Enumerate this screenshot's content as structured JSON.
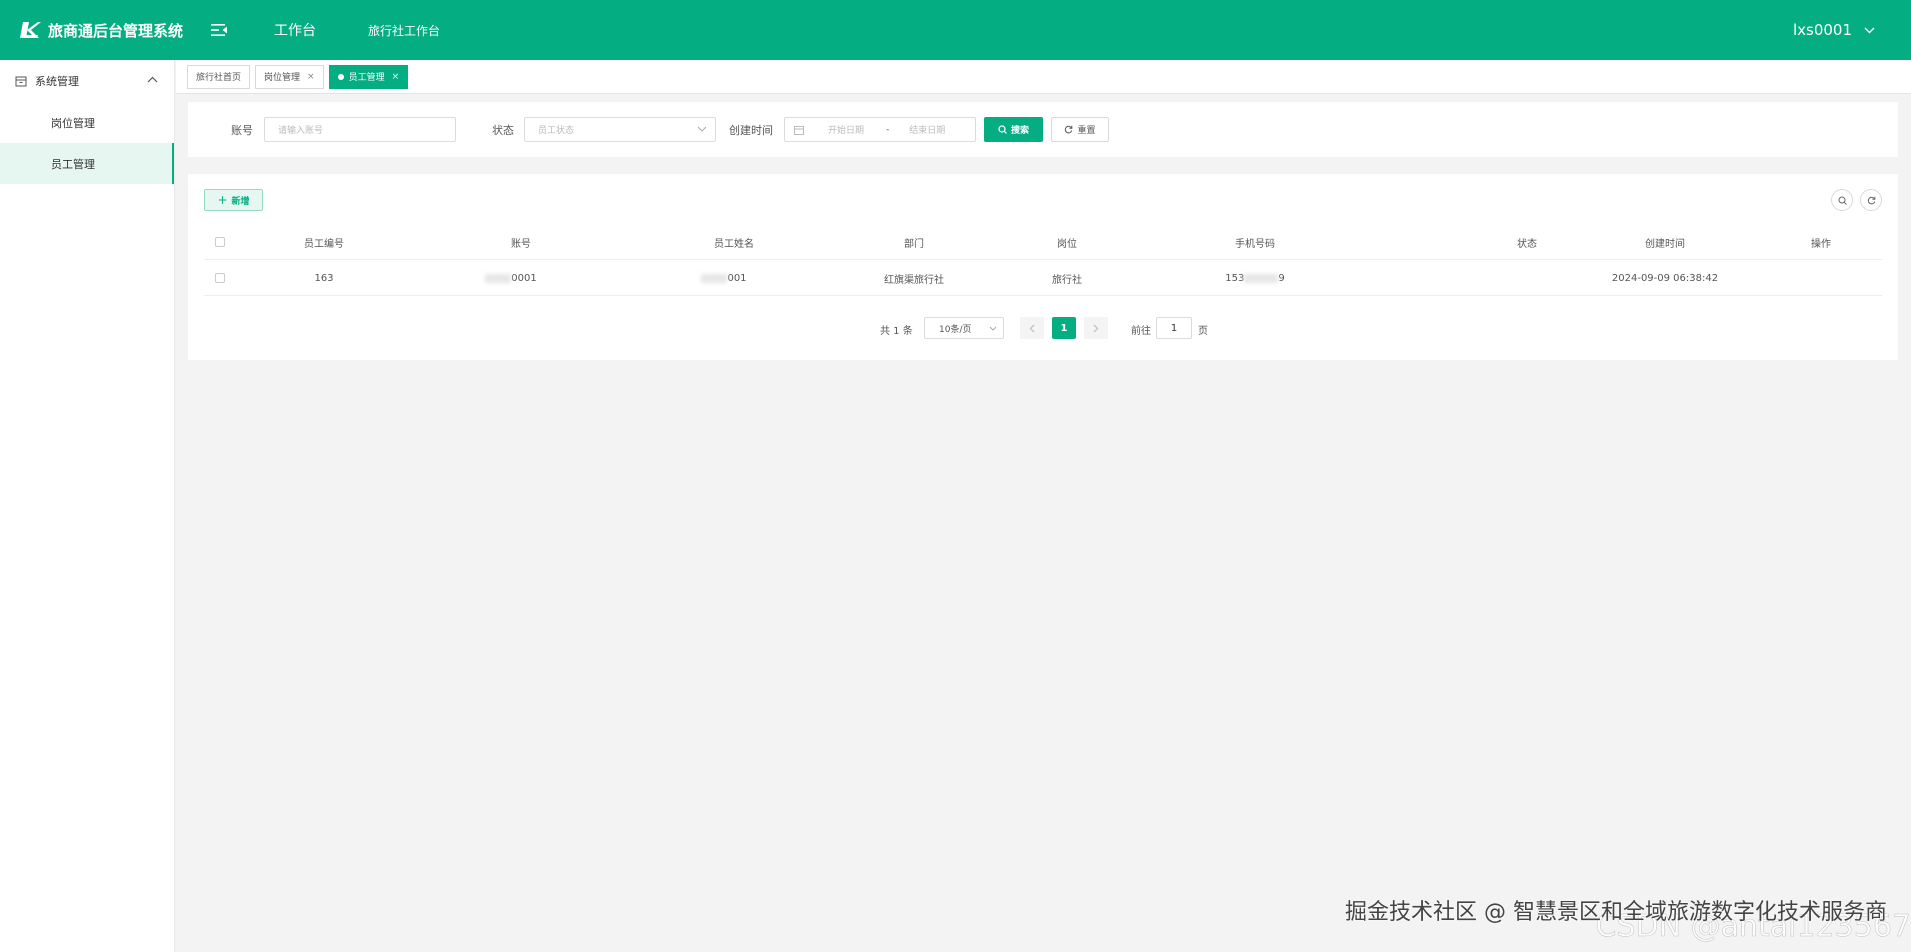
{
  "header": {
    "app_title": "旅商通后台管理系统",
    "nav": [
      "工作台",
      "旅行社工作台"
    ],
    "user_name": "lxs0001"
  },
  "sidebar": {
    "group_label": "系统管理",
    "items": [
      {
        "label": "岗位管理",
        "active": false
      },
      {
        "label": "员工管理",
        "active": true
      }
    ]
  },
  "tags": [
    {
      "label": "旅行社首页",
      "closable": false,
      "active": false
    },
    {
      "label": "岗位管理",
      "closable": true,
      "active": false
    },
    {
      "label": "员工管理",
      "closable": true,
      "active": true
    }
  ],
  "search": {
    "account_label": "账号",
    "account_placeholder": "请输入账号",
    "status_label": "状态",
    "status_placeholder": "员工状态",
    "created_label": "创建时间",
    "start_placeholder": "开始日期",
    "range_separator": "-",
    "end_placeholder": "结束日期",
    "search_button": "搜索",
    "reset_button": "重置"
  },
  "toolbar": {
    "add_button": "新增"
  },
  "table": {
    "columns": [
      "员工编号",
      "账号",
      "员工姓名",
      "部门",
      "岗位",
      "手机号码",
      "状态",
      "创建时间",
      "操作"
    ],
    "rows": [
      {
        "id": "163",
        "account_suffix": "0001",
        "name_suffix": "001",
        "department": "红旗渠旅行社",
        "position": "旅行社",
        "phone_prefix": "153",
        "phone_suffix": "9",
        "status": "",
        "created_at": "2024-09-09 06:38:42",
        "actions": ""
      }
    ]
  },
  "pagination": {
    "total_text": "共 1 条",
    "page_size": "10条/页",
    "current_page": "1",
    "goto_label": "前往",
    "goto_value": "1",
    "page_suffix": "页"
  },
  "watermark": {
    "text": "掘金技术社区 @ 智慧景区和全域旅游数字化技术服务商",
    "faint_text": "CSDN @antai123567"
  },
  "colors": {
    "brand": "#04ad82",
    "page_bg": "#f3f3f3"
  }
}
